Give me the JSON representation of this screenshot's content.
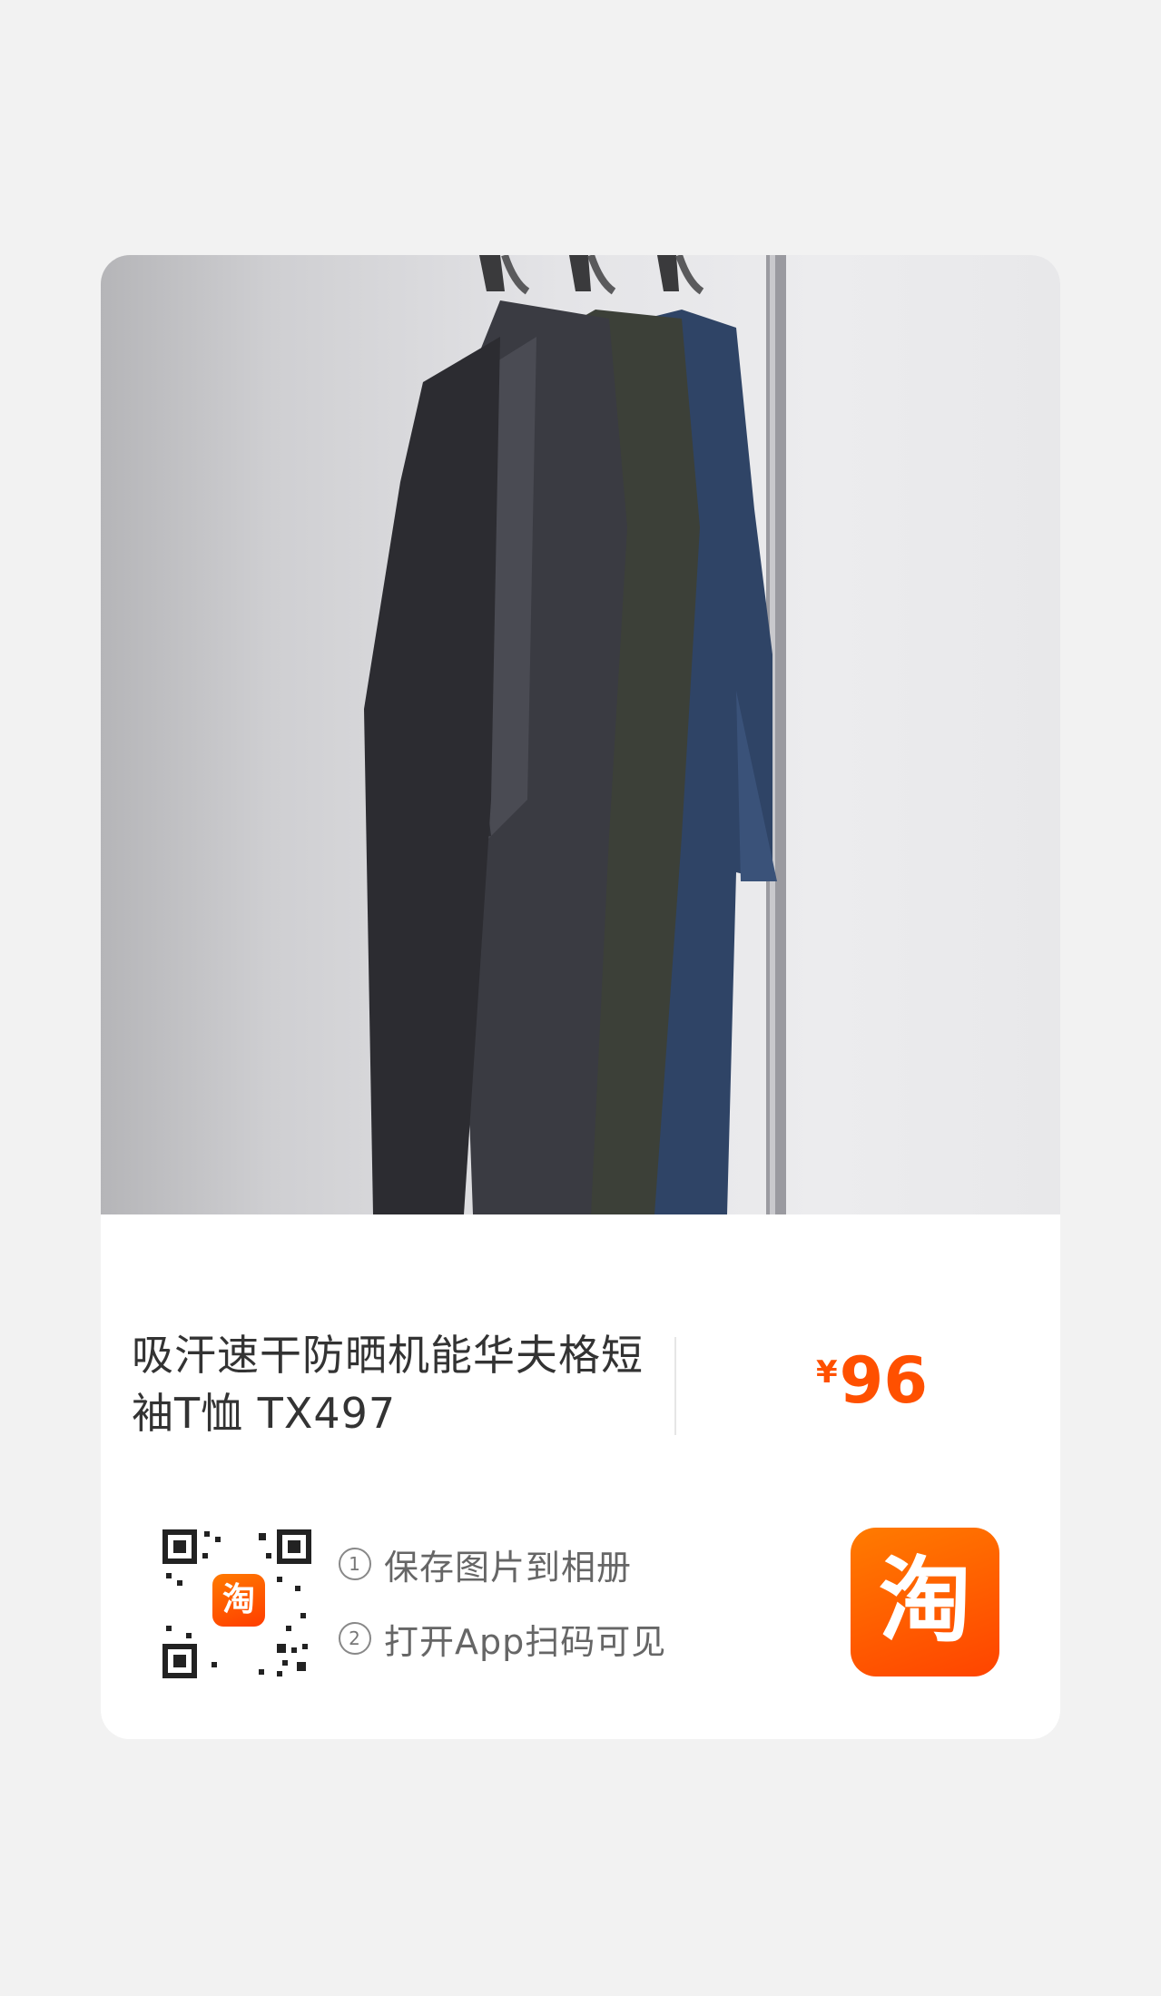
{
  "product": {
    "title_line1": "吸汗速干防晒机能华夫格短",
    "title_line2": "袖T恤 TX497",
    "price_symbol": "¥",
    "price_value": "96",
    "image_icon": "hanging-tshirts-photo"
  },
  "share": {
    "qr_icon": "qr-code-icon",
    "qr_logo_text": "淘",
    "step1_num": "1",
    "step1_text": "保存图片到相册",
    "step2_num": "2",
    "step2_text": "打开App扫码可见",
    "app_logo_text": "淘"
  },
  "colors": {
    "accent": "#ff5000",
    "background": "#f2f2f2",
    "card": "#ffffff"
  }
}
